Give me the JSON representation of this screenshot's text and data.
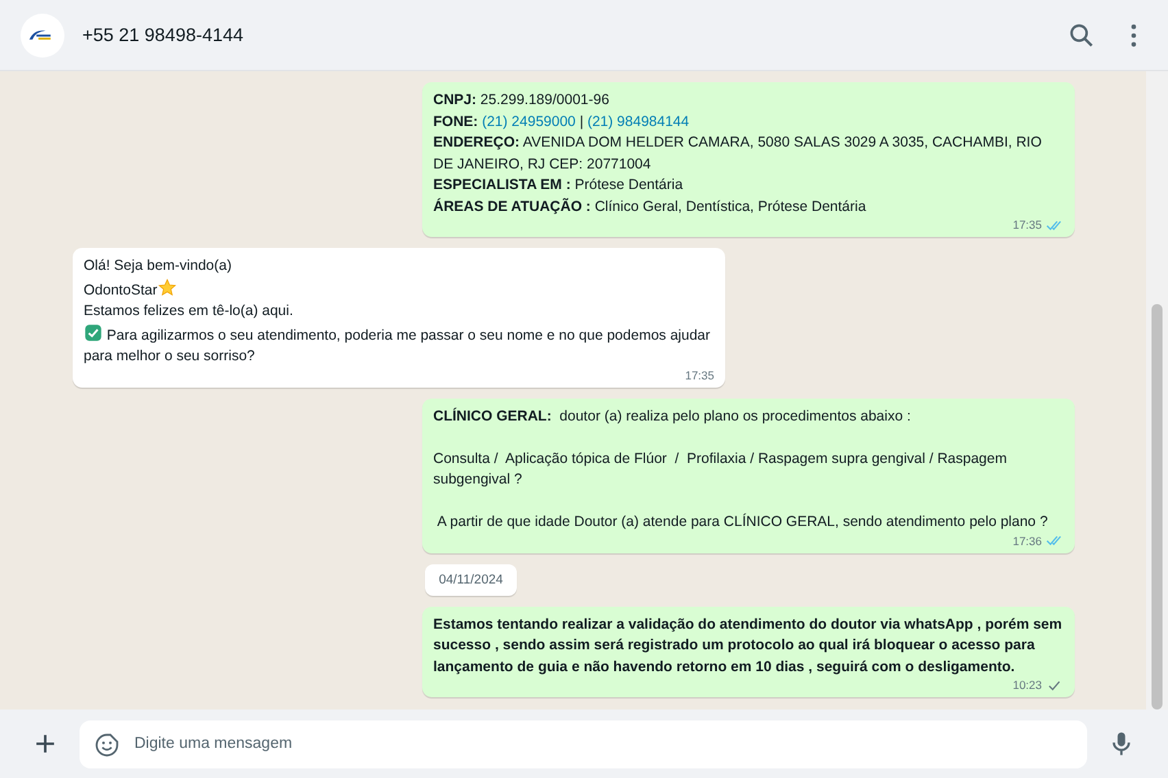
{
  "header": {
    "contact": "+55 21 98498-4144"
  },
  "messages": [
    {
      "kind": "outgoing",
      "bold": false,
      "delivered": true,
      "read": true,
      "time": "17:35",
      "lines": [
        [
          {
            "kind": "bold",
            "text": "CNPJ:"
          },
          {
            "kind": "plain",
            "text": " 25.299.189/0001-96"
          }
        ],
        [
          {
            "kind": "bold",
            "text": "FONE: "
          },
          {
            "kind": "link",
            "text": "(21) 24959000"
          },
          {
            "kind": "plain",
            "text": " | "
          },
          {
            "kind": "link",
            "text": "(21) 984984144"
          }
        ],
        [
          {
            "kind": "bold",
            "text": "ENDEREÇO:"
          },
          {
            "kind": "plain",
            "text": " AVENIDA DOM HELDER CAMARA, 5080 SALAS 3029 A 3035, CACHAMBI, RIO DE JANEIRO, RJ CEP: 20771004"
          }
        ],
        [
          {
            "kind": "bold",
            "text": "ESPECIALISTA EM :"
          },
          {
            "kind": "plain",
            "text": " Prótese Dentária"
          }
        ],
        [
          {
            "kind": "bold",
            "text": "ÁREAS DE ATUAÇÃO :"
          },
          {
            "kind": "plain",
            "text": " Clínico Geral, Dentística, Prótese Dentária"
          }
        ]
      ]
    },
    {
      "kind": "incoming",
      "bold": false,
      "time": "17:35",
      "lines": [
        [
          {
            "kind": "plain",
            "text": "Olá! Seja bem-vindo(a)"
          }
        ],
        [
          {
            "kind": "plain",
            "text": "OdontoStar"
          },
          {
            "kind": "star"
          }
        ],
        [
          {
            "kind": "plain",
            "text": "Estamos felizes em tê-lo(a) aqui."
          }
        ],
        [
          {
            "kind": "check"
          },
          {
            "kind": "plain",
            "text": " Para agilizarmos o seu atendimento, poderia me passar o seu nome e no que podemos ajudar para melhor o seu sorriso?"
          }
        ]
      ]
    },
    {
      "kind": "outgoing",
      "bold": false,
      "delivered": true,
      "read": true,
      "time": "17:36",
      "lines": [
        [
          {
            "kind": "bold",
            "text": "CLÍNICO GERAL:"
          },
          {
            "kind": "plain",
            "text": "  doutor (a) realiza pelo plano os procedimentos abaixo :\n\nConsulta /  Aplicação tópica de Flúor  /  Profilaxia / Raspagem supra gengival / Raspagem subgengival ?\n\n A partir de que idade Doutor (a) atende para CLÍNICO GERAL, sendo atendimento pelo plano ?"
          }
        ]
      ]
    },
    {
      "kind": "date",
      "text": "04/11/2024"
    },
    {
      "kind": "outgoing",
      "bold": true,
      "delivered": false,
      "read": false,
      "time": "10:23",
      "lines": [
        [
          {
            "kind": "plain",
            "text": "Estamos tentando realizar a validação do atendimento do doutor via whatsApp , porém sem sucesso , sendo assim será registrado um protocolo ao qual irá bloquear o acesso para lançamento de guia e não havendo retorno em 10 dias , seguirá com o desligamento."
          }
        ]
      ]
    }
  ],
  "composer": {
    "placeholder": "Digite uma mensagem"
  }
}
